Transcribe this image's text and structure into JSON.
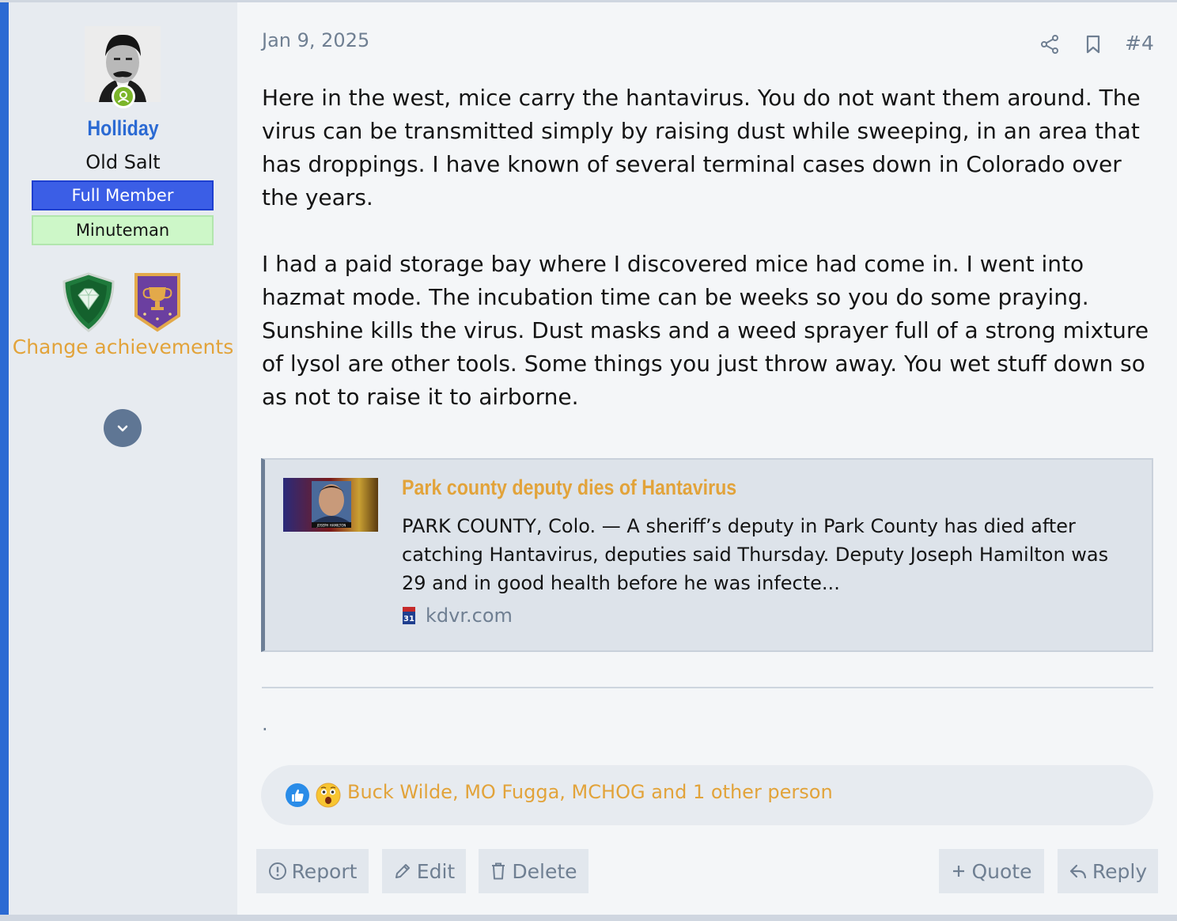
{
  "user": {
    "name": "Holliday",
    "title": "Old Salt",
    "banners": [
      "Full Member",
      "Minuteman"
    ],
    "achievements_link": "Change achievements"
  },
  "post": {
    "date": "Jan 9, 2025",
    "number": "#4",
    "paragraphs": [
      "Here in the west, mice carry the hantavirus. You do not want them around. The virus can be transmitted simply by raising dust while sweeping, in an area that has droppings. I have known of several terminal cases down in Colorado over the years.",
      "I had a paid storage bay where I discovered mice had come in. I went into hazmat mode. The incubation time can be weeks so you do some praying. Sunshine kills the virus. Dust masks and a weed sprayer full of a strong mixture of lysol are other tools. Some things you just throw away. You wet stuff down so as not to raise it to airborne."
    ],
    "separator_text": "."
  },
  "embed": {
    "title": "Park county deputy dies of Hantavirus",
    "description": "PARK COUNTY, Colo. — A sheriff’s deputy in Park County has died after catching Hantavirus, deputies said Thursday. Deputy Joseph Hamilton was 29 and in good health before he was infecte...",
    "source": "kdvr.com",
    "favicon_text": "31",
    "thumb_caption": "JOSEPH HAMILTON"
  },
  "reactions": {
    "icons": [
      "like-icon",
      "wow-icon"
    ],
    "users_text": "Buck Wilde, MO Fugga, MCHOG and 1 other person"
  },
  "actions": {
    "report": "Report",
    "edit": "Edit",
    "delete": "Delete",
    "quote": "Quote",
    "reply": "Reply"
  },
  "colors": {
    "accent": "#2b6ad3",
    "link": "#e2a33a",
    "muted": "#6f7f92",
    "full_member": "#3b5ee6",
    "minuteman": "#cdf7c8"
  }
}
